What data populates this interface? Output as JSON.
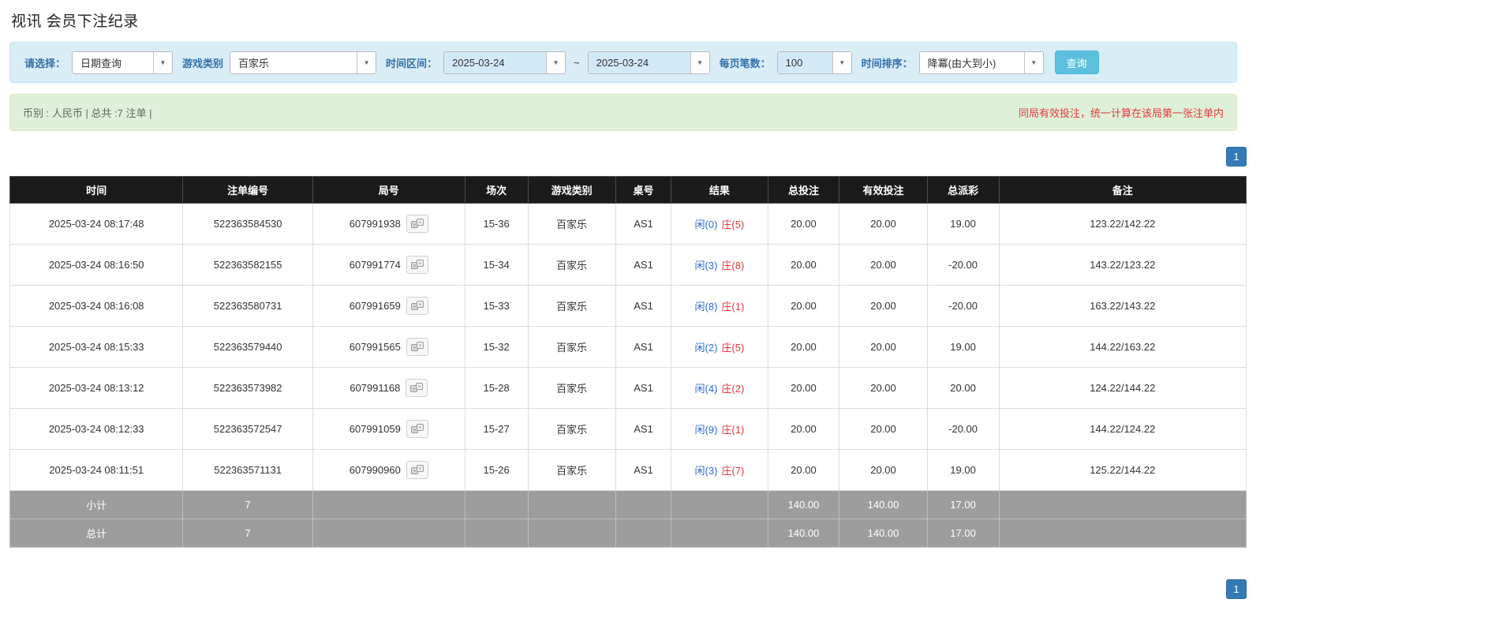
{
  "page": {
    "title": "视讯 会员下注纪录"
  },
  "filters": {
    "select_label": "请选择：",
    "select_value": "日期查询",
    "game_type_label": "游戏类别",
    "game_type_value": "百家乐",
    "date_range_label": "时间区间：",
    "date_from": "2025-03-24",
    "range_separator": "~",
    "date_to": "2025-03-24",
    "page_size_label": "每页笔数：",
    "page_size_value": "100",
    "sort_label": "时间排序：",
    "sort_value": "降冪(由大到小)",
    "search_button_label": "查询"
  },
  "info_bar": {
    "summary_text": "币别 : 人民币 | 总共 :7 注单 |",
    "notice_text": "同局有效投注，统一计算在该局第一张注单内"
  },
  "pagination": {
    "current_page": "1"
  },
  "icons": {
    "round_detail": "dice-icon",
    "combo_caret": "chevron-down-icon"
  },
  "colors": {
    "filter_bar_bg": "#d9edf7",
    "info_bar_bg": "#dff0d8",
    "search_button": "#5bc0de",
    "pagination_active": "#337ab7",
    "table_header_bg": "#1b1b1b",
    "summary_row_bg": "#9d9d9d",
    "player_blue": "#2a6bd4",
    "banker_red": "#e4393c",
    "amount_blue": "#337ab7",
    "negative_red": "#e4393c",
    "notice_red": "#e4393c"
  },
  "table": {
    "headers": [
      "时间",
      "注单编号",
      "局号",
      "场次",
      "游戏类别",
      "桌号",
      "结果",
      "总投注",
      "有效投注",
      "总派彩",
      "备注"
    ],
    "rows": [
      {
        "time": "2025-03-24 08:17:48",
        "bet_id": "522363584530",
        "round_id": "607991938",
        "session": "15-36",
        "game": "百家乐",
        "table_no": "AS1",
        "result_player": "闲(0)",
        "result_banker": "庄(5)",
        "total_bet": "20.00",
        "valid_bet": "20.00",
        "payout": "19.00",
        "note": "123.22/142.22"
      },
      {
        "time": "2025-03-24 08:16:50",
        "bet_id": "522363582155",
        "round_id": "607991774",
        "session": "15-34",
        "game": "百家乐",
        "table_no": "AS1",
        "result_player": "闲(3)",
        "result_banker": "庄(8)",
        "total_bet": "20.00",
        "valid_bet": "20.00",
        "payout": "-20.00",
        "note": "143.22/123.22"
      },
      {
        "time": "2025-03-24 08:16:08",
        "bet_id": "522363580731",
        "round_id": "607991659",
        "session": "15-33",
        "game": "百家乐",
        "table_no": "AS1",
        "result_player": "闲(8)",
        "result_banker": "庄(1)",
        "total_bet": "20.00",
        "valid_bet": "20.00",
        "payout": "-20.00",
        "note": "163.22/143.22"
      },
      {
        "time": "2025-03-24 08:15:33",
        "bet_id": "522363579440",
        "round_id": "607991565",
        "session": "15-32",
        "game": "百家乐",
        "table_no": "AS1",
        "result_player": "闲(2)",
        "result_banker": "庄(5)",
        "total_bet": "20.00",
        "valid_bet": "20.00",
        "payout": "19.00",
        "note": "144.22/163.22"
      },
      {
        "time": "2025-03-24 08:13:12",
        "bet_id": "522363573982",
        "round_id": "607991168",
        "session": "15-28",
        "game": "百家乐",
        "table_no": "AS1",
        "result_player": "闲(4)",
        "result_banker": "庄(2)",
        "total_bet": "20.00",
        "valid_bet": "20.00",
        "payout": "20.00",
        "note": "124.22/144.22"
      },
      {
        "time": "2025-03-24 08:12:33",
        "bet_id": "522363572547",
        "round_id": "607991059",
        "session": "15-27",
        "game": "百家乐",
        "table_no": "AS1",
        "result_player": "闲(9)",
        "result_banker": "庄(1)",
        "total_bet": "20.00",
        "valid_bet": "20.00",
        "payout": "-20.00",
        "note": "144.22/124.22"
      },
      {
        "time": "2025-03-24 08:11:51",
        "bet_id": "522363571131",
        "round_id": "607990960",
        "session": "15-26",
        "game": "百家乐",
        "table_no": "AS1",
        "result_player": "闲(3)",
        "result_banker": "庄(7)",
        "total_bet": "20.00",
        "valid_bet": "20.00",
        "payout": "19.00",
        "note": "125.22/144.22"
      }
    ],
    "subtotal": {
      "label": "小计",
      "count": "7",
      "total_bet": "140.00",
      "valid_bet": "140.00",
      "payout": "17.00"
    },
    "grand_total": {
      "label": "总计",
      "count": "7",
      "total_bet": "140.00",
      "valid_bet": "140.00",
      "payout": "17.00"
    }
  }
}
